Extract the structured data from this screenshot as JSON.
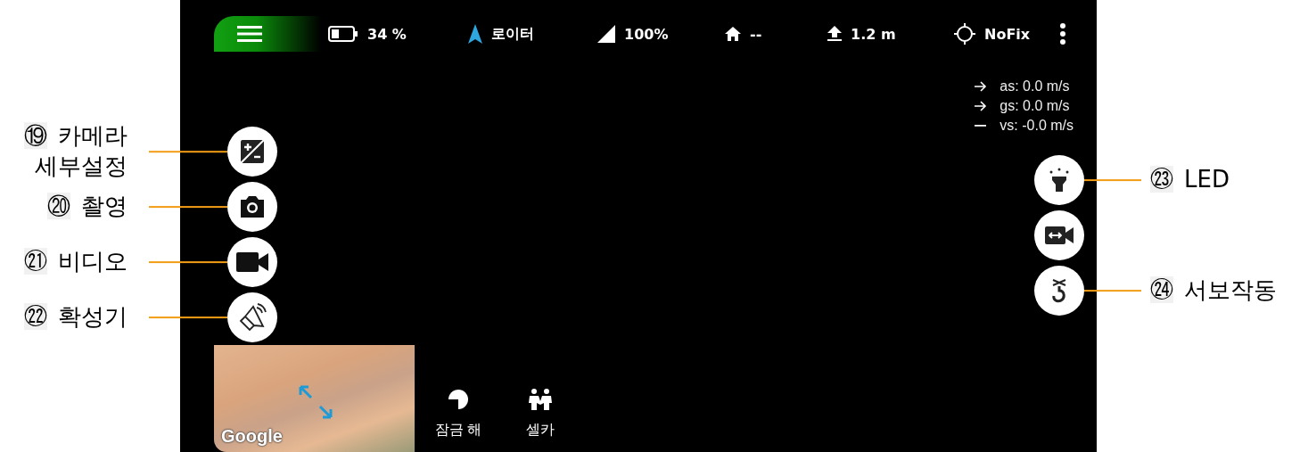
{
  "top_bar": {
    "items": [
      {
        "kind": "battery",
        "text": "34 %"
      },
      {
        "kind": "mode",
        "text": "로이터"
      },
      {
        "kind": "signal",
        "text": "100%"
      },
      {
        "kind": "home",
        "text": "--"
      },
      {
        "kind": "altitude",
        "text": "1.2 m"
      },
      {
        "kind": "gps",
        "text": "NoFix"
      }
    ]
  },
  "speeds": [
    {
      "kind": "arrow",
      "text": "as: 0.0 m/s"
    },
    {
      "kind": "arrow",
      "text": "gs: 0.0 m/s"
    },
    {
      "kind": "dash",
      "text": "vs: -0.0 m/s"
    }
  ],
  "left_buttons": [
    {
      "kind": "exposure",
      "callout": {
        "number": "⑲",
        "lines": [
          "카메라",
          "세부설정"
        ]
      }
    },
    {
      "kind": "camera",
      "callout": {
        "number": "⑳",
        "lines": [
          "촬영"
        ]
      }
    },
    {
      "kind": "video",
      "callout": {
        "number": "㉑",
        "lines": [
          "비디오"
        ]
      }
    },
    {
      "kind": "speaker",
      "callout": {
        "number": "㉒",
        "lines": [
          "확성기"
        ]
      }
    }
  ],
  "right_buttons": [
    {
      "kind": "led",
      "callout": {
        "number": "㉓",
        "lines": [
          "LED"
        ]
      }
    },
    {
      "kind": "camera_switch"
    },
    {
      "kind": "hook",
      "callout": {
        "number": "㉔",
        "lines": [
          "서보작동"
        ]
      }
    }
  ],
  "map": {
    "attribution": "Google"
  },
  "bottom_actions": [
    {
      "kind": "unlock",
      "label": "잠금 해"
    },
    {
      "kind": "selfie",
      "label": "셀카"
    }
  ]
}
